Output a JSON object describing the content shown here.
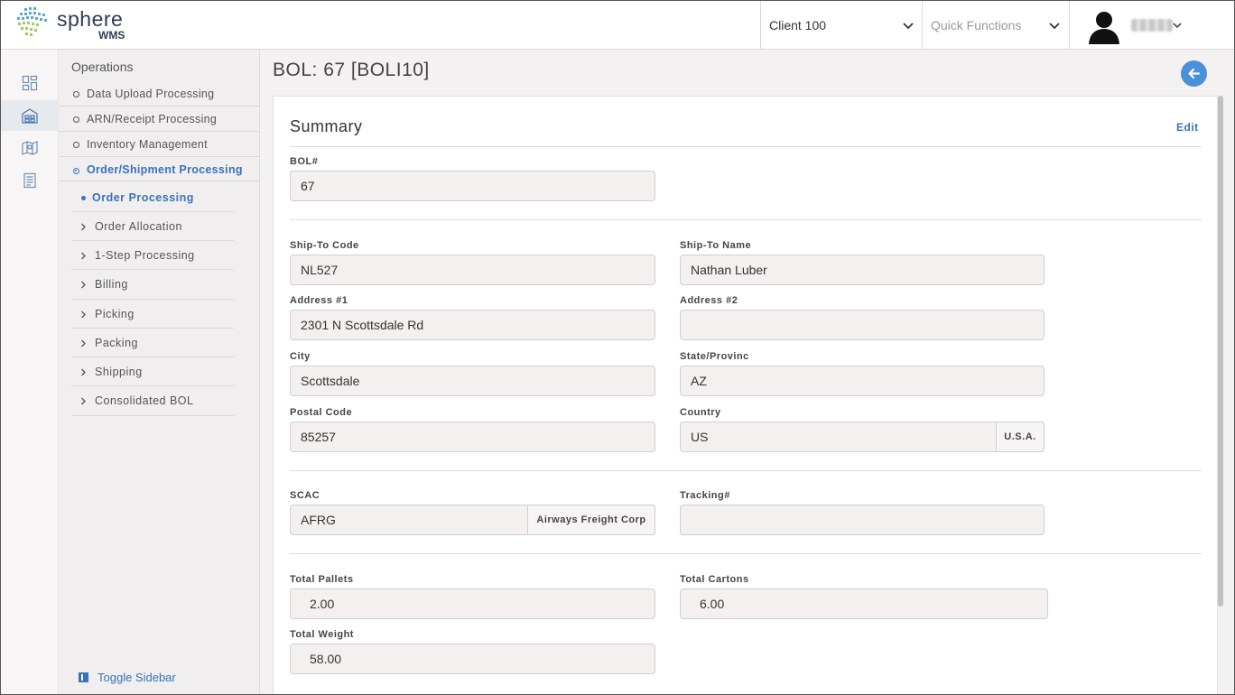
{
  "app": {
    "logo_name": "sphere",
    "logo_sub": "WMS",
    "brand_color": "#3a73b8"
  },
  "header": {
    "client_select": "Client 100",
    "quick_functions_placeholder": "Quick Functions"
  },
  "rail": {
    "items": [
      "dashboard-icon",
      "warehouse-icon",
      "map-icon",
      "report-icon"
    ]
  },
  "sidebar": {
    "title": "Operations",
    "items": [
      {
        "label": "Data Upload Processing"
      },
      {
        "label": "ARN/Receipt Processing"
      },
      {
        "label": "Inventory Management"
      },
      {
        "label": "Order/Shipment Processing"
      }
    ],
    "subitems": [
      {
        "label": "Order Processing"
      },
      {
        "label": "Order Allocation"
      },
      {
        "label": "1-Step Processing"
      },
      {
        "label": "Billing"
      },
      {
        "label": "Picking"
      },
      {
        "label": "Packing"
      },
      {
        "label": "Shipping"
      },
      {
        "label": "Consolidated BOL"
      }
    ],
    "toggle_label": "Toggle Sidebar"
  },
  "page": {
    "title": "BOL: 67 [BOLI10]"
  },
  "summary": {
    "title": "Summary",
    "edit_label": "Edit",
    "bol_label": "BOL#",
    "bol_value": "67",
    "ship_to_code_label": "Ship-To Code",
    "ship_to_code": "NL527",
    "ship_to_name_label": "Ship-To Name",
    "ship_to_name": "Nathan Luber",
    "address1_label": "Address #1",
    "address1": "2301 N Scottsdale Rd",
    "address2_label": "Address #2",
    "address2": "",
    "city_label": "City",
    "city": "Scottsdale",
    "state_label": "State/Provinc",
    "state": "AZ",
    "postal_label": "Postal Code",
    "postal": "85257",
    "country_label": "Country",
    "country": "US",
    "country_addon": "U.S.A.",
    "scac_label": "SCAC",
    "scac": "AFRG",
    "scac_addon": "Airways Freight Corp",
    "tracking_label": "Tracking#",
    "tracking": "",
    "total_pallets_label": "Total Pallets",
    "total_pallets": "2.00",
    "total_cartons_label": "Total Cartons",
    "total_cartons": "6.00",
    "total_weight_label": "Total Weight",
    "total_weight": "58.00"
  }
}
